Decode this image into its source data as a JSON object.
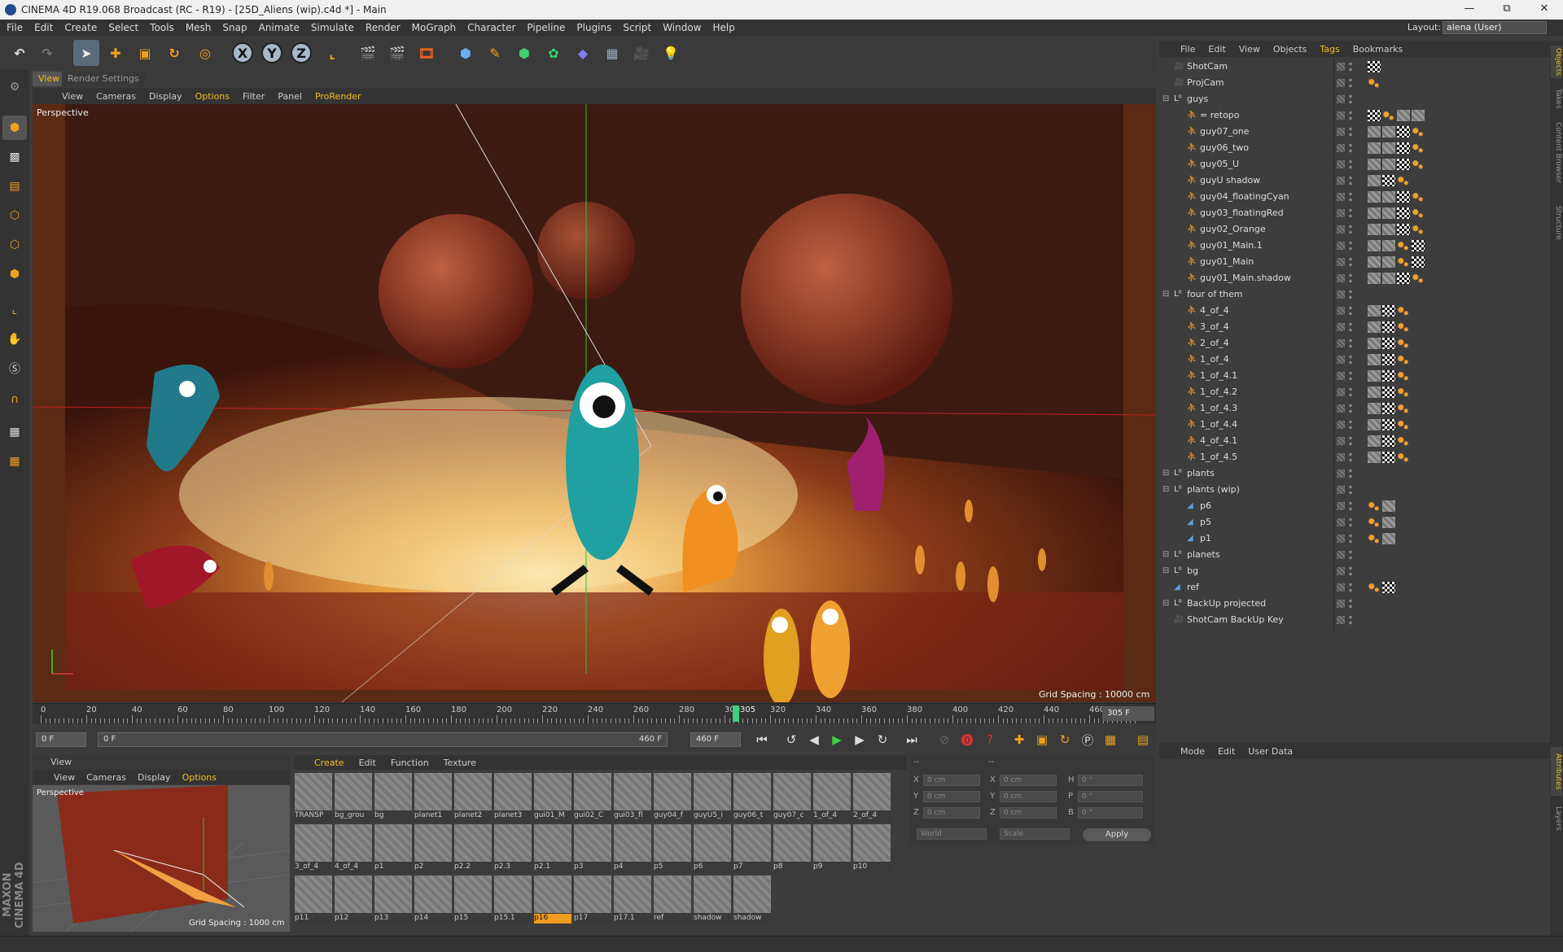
{
  "window": {
    "title": "CINEMA 4D R19.068 Broadcast (RC - R19) - [25D_Aliens (wip).c4d *] - Main",
    "minimize": "—",
    "maximize": "⧉",
    "close": "✕"
  },
  "menu": [
    "File",
    "Edit",
    "Create",
    "Select",
    "Tools",
    "Mesh",
    "Snap",
    "Animate",
    "Simulate",
    "Render",
    "MoGraph",
    "Character",
    "Pipeline",
    "Plugins",
    "Script",
    "Window",
    "Help"
  ],
  "layout": {
    "label": "Layout:",
    "value": "alena (User)"
  },
  "viewport": {
    "tabs": [
      "View",
      "Render Settings"
    ],
    "menu": [
      "View",
      "Cameras",
      "Display",
      "Options",
      "Filter",
      "Panel",
      "ProRender"
    ],
    "active_menu": "Options",
    "label": "Perspective",
    "grid_spacing": "Grid Spacing : 10000 cm"
  },
  "timeline": {
    "ticks": [
      "0",
      "20",
      "40",
      "60",
      "80",
      "100",
      "120",
      "140",
      "160",
      "180",
      "200",
      "220",
      "240",
      "260",
      "280",
      "300",
      "320",
      "340",
      "360",
      "380",
      "400",
      "420",
      "440",
      "460"
    ],
    "current": "305",
    "current_frame_field": "305 F",
    "start_field": "0 F",
    "range_start": "0 F",
    "range_end": "460 F",
    "end_field": "460 F"
  },
  "viewport2": {
    "title": "View",
    "menu": [
      "View",
      "Cameras",
      "Display",
      "Options"
    ],
    "active_menu": "Options",
    "label": "Perspective",
    "grid_spacing": "Grid Spacing : 1000 cm"
  },
  "materials": {
    "menu": [
      "Create",
      "Edit",
      "Function",
      "Texture"
    ],
    "active_menu": "Create",
    "items": [
      "TRANSP",
      "bg_grou",
      "bg",
      "planet1",
      "planet2",
      "planet3",
      "gui01_M",
      "gui02_C",
      "gui03_fl",
      "guy04_f",
      "guyU5_i",
      "guy06_t",
      "guy07_c",
      "1_of_4",
      "2_of_4",
      "3_of_4",
      "4_of_4",
      "p1",
      "p2",
      "p2.2",
      "p2.3",
      "p2.1",
      "p3",
      "p4",
      "p5",
      "p6",
      "p7",
      "p8",
      "p9",
      "p10",
      "p11",
      "p12",
      "p13",
      "p14",
      "p15",
      "p15.1",
      "p16",
      "p17",
      "p17.1",
      "ref",
      "shadow",
      "shadow"
    ],
    "selected": "p16"
  },
  "coords": {
    "rows": [
      {
        "a": "X",
        "av": "0 cm",
        "b": "X",
        "bv": "0 cm",
        "c": "H",
        "cv": "0 °"
      },
      {
        "a": "Y",
        "av": "0 cm",
        "b": "Y",
        "bv": "0 cm",
        "c": "P",
        "cv": "0 °"
      },
      {
        "a": "Z",
        "av": "0 cm",
        "b": "Z",
        "bv": "0 cm",
        "c": "B",
        "cv": "0 °"
      }
    ],
    "header1": "--",
    "header2": "--",
    "world": "World",
    "scale": "Scale",
    "apply": "Apply"
  },
  "object_manager": {
    "menu": [
      "File",
      "Edit",
      "View",
      "Objects",
      "Tags",
      "Bookmarks"
    ],
    "active_menu": "Tags",
    "objects": [
      {
        "name": "ShotCam",
        "depth": 0,
        "type": "cam",
        "tags": [
          "chk"
        ]
      },
      {
        "name": "ProjCam",
        "depth": 0,
        "type": "cam",
        "tags": [
          "or"
        ]
      },
      {
        "name": "guys",
        "depth": 0,
        "type": "null",
        "tags": []
      },
      {
        "name": "= retopo",
        "depth": 1,
        "type": "fig",
        "tags": [
          "chk",
          "or",
          "tex",
          "tex"
        ]
      },
      {
        "name": "guy07_one",
        "depth": 1,
        "type": "fig",
        "tags": [
          "tex",
          "tex",
          "chk",
          "or"
        ]
      },
      {
        "name": "guy06_two",
        "depth": 1,
        "type": "fig",
        "tags": [
          "tex",
          "tex",
          "chk",
          "or"
        ]
      },
      {
        "name": "guy05_U",
        "depth": 1,
        "type": "fig",
        "tags": [
          "tex",
          "tex",
          "chk",
          "or"
        ]
      },
      {
        "name": "guyU shadow",
        "depth": 1,
        "type": "fig",
        "tags": [
          "tex",
          "chk",
          "or"
        ]
      },
      {
        "name": "guy04_floatingCyan",
        "depth": 1,
        "type": "fig",
        "tags": [
          "tex",
          "tex",
          "chk",
          "or"
        ]
      },
      {
        "name": "guy03_floatingRed",
        "depth": 1,
        "type": "fig",
        "tags": [
          "tex",
          "tex",
          "chk",
          "or"
        ]
      },
      {
        "name": "guy02_Orange",
        "depth": 1,
        "type": "fig",
        "tags": [
          "tex",
          "tex",
          "chk",
          "or"
        ]
      },
      {
        "name": "guy01_Main.1",
        "depth": 1,
        "type": "fig",
        "tags": [
          "tex",
          "tex",
          "or",
          "chk"
        ]
      },
      {
        "name": "guy01_Main",
        "depth": 1,
        "type": "fig",
        "tags": [
          "tex",
          "tex",
          "or",
          "chk"
        ]
      },
      {
        "name": "guy01_Main.shadow",
        "depth": 1,
        "type": "fig",
        "tags": [
          "tex",
          "tex",
          "chk",
          "or"
        ]
      },
      {
        "name": "four of them",
        "depth": 0,
        "type": "null",
        "tags": []
      },
      {
        "name": "4_of_4",
        "depth": 1,
        "type": "fig",
        "tags": [
          "tex",
          "chk",
          "or"
        ]
      },
      {
        "name": "3_of_4",
        "depth": 1,
        "type": "fig",
        "tags": [
          "tex",
          "chk",
          "or"
        ]
      },
      {
        "name": "2_of_4",
        "depth": 1,
        "type": "fig",
        "tags": [
          "tex",
          "chk",
          "or"
        ]
      },
      {
        "name": "1_of_4",
        "depth": 1,
        "type": "fig",
        "tags": [
          "tex",
          "chk",
          "or"
        ]
      },
      {
        "name": "1_of_4.1",
        "depth": 1,
        "type": "fig",
        "tags": [
          "tex",
          "chk",
          "or"
        ]
      },
      {
        "name": "1_of_4.2",
        "depth": 1,
        "type": "fig",
        "tags": [
          "tex",
          "chk",
          "or"
        ]
      },
      {
        "name": "1_of_4.3",
        "depth": 1,
        "type": "fig",
        "tags": [
          "tex",
          "chk",
          "or"
        ]
      },
      {
        "name": "1_of_4.4",
        "depth": 1,
        "type": "fig",
        "tags": [
          "tex",
          "chk",
          "or"
        ]
      },
      {
        "name": "4_of_4.1",
        "depth": 1,
        "type": "fig",
        "tags": [
          "tex",
          "chk",
          "or"
        ]
      },
      {
        "name": "1_of_4.5",
        "depth": 1,
        "type": "fig",
        "tags": [
          "tex",
          "chk",
          "or"
        ]
      },
      {
        "name": "plants",
        "depth": 0,
        "type": "null",
        "tags": []
      },
      {
        "name": "plants (wip)",
        "depth": 0,
        "type": "null",
        "tags": []
      },
      {
        "name": "p6",
        "depth": 1,
        "type": "plane",
        "tags": [
          "or",
          "tex"
        ]
      },
      {
        "name": "p5",
        "depth": 1,
        "type": "plane",
        "tags": [
          "or",
          "tex"
        ]
      },
      {
        "name": "p1",
        "depth": 1,
        "type": "plane",
        "tags": [
          "or",
          "tex"
        ]
      },
      {
        "name": "planets",
        "depth": 0,
        "type": "null",
        "tags": []
      },
      {
        "name": "bg",
        "depth": 0,
        "type": "null",
        "tags": []
      },
      {
        "name": "ref",
        "depth": 0,
        "type": "plane",
        "tags": [
          "or",
          "chk"
        ]
      },
      {
        "name": "BackUp projected",
        "depth": 0,
        "type": "null",
        "tags": []
      },
      {
        "name": "ShotCam BackUp Key",
        "depth": 0,
        "type": "cam",
        "tags": []
      }
    ]
  },
  "attributes": {
    "menu": [
      "Mode",
      "Edit",
      "User Data"
    ]
  },
  "right_tabs": [
    "Objects",
    "Takes",
    "Content Browser",
    "Structure"
  ],
  "right_tabs2": [
    "Attributes",
    "Layers"
  ],
  "branding": "MAXON CINEMA 4D",
  "colors": {
    "accent": "#f0c020",
    "selection": "#f09a20",
    "timeline_cursor": "#40d080"
  }
}
